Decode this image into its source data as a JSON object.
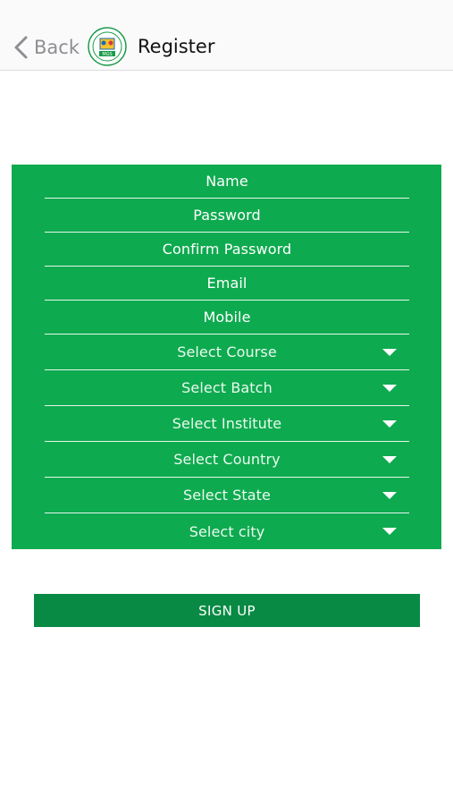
{
  "navbar": {
    "back_label": "Back",
    "title": "Register",
    "logo_text": "MGS"
  },
  "form": {
    "fields": [
      {
        "label": "Name"
      },
      {
        "label": "Password"
      },
      {
        "label": "Confirm Password"
      },
      {
        "label": "Email"
      },
      {
        "label": "Mobile"
      }
    ],
    "selects": [
      {
        "label": "Select Course"
      },
      {
        "label": "Select Batch"
      },
      {
        "label": "Select Institute"
      },
      {
        "label": "Select Country"
      },
      {
        "label": "Select State"
      },
      {
        "label": "Select city"
      }
    ]
  },
  "signup_label": "SIGN UP",
  "colors": {
    "form_green": "#0eaa4f",
    "button_green": "#098a44",
    "back_gray": "#8e8e93"
  }
}
